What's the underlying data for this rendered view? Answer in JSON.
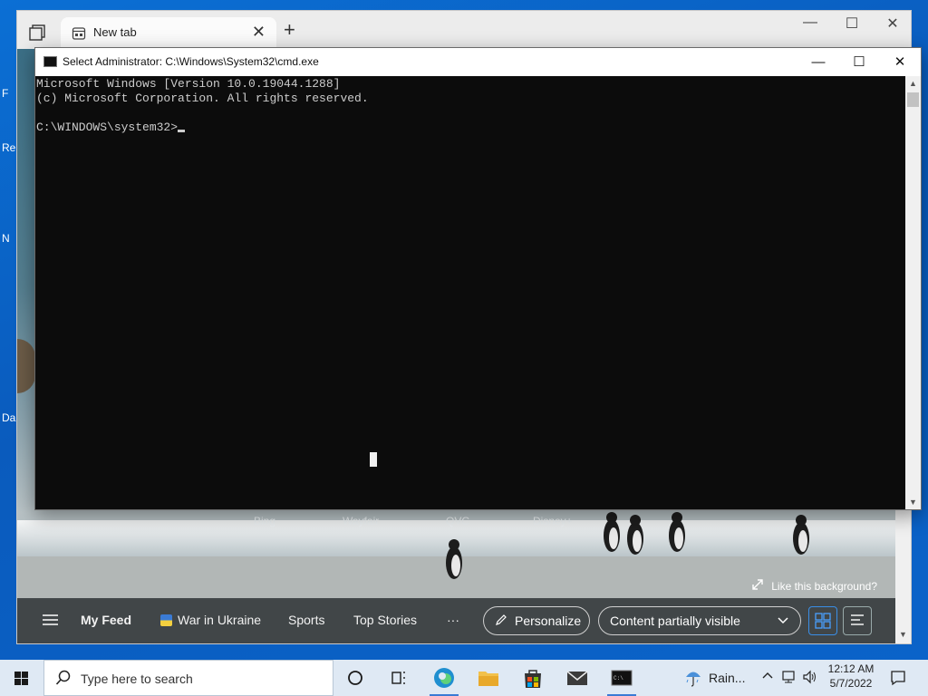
{
  "desktop": {
    "fragments": [
      "Re",
      "F",
      "N",
      "Da"
    ]
  },
  "edge": {
    "tab": {
      "title": "New tab"
    },
    "quick_links": [
      "Bing",
      "Wayfair",
      "QVC",
      "Disney+"
    ],
    "background_link": "Like this background?",
    "feed": {
      "my_feed": "My Feed",
      "war_in_ukraine": "War in Ukraine",
      "sports": "Sports",
      "top_stories": "Top Stories",
      "more": "···",
      "personalize": "Personalize",
      "content_visibility": "Content partially visible"
    }
  },
  "cmd": {
    "title": "Select Administrator: C:\\Windows\\System32\\cmd.exe",
    "lines": [
      "Microsoft Windows [Version 10.0.19044.1288]",
      "(c) Microsoft Corporation. All rights reserved.",
      ""
    ],
    "prompt": "C:\\WINDOWS\\system32>"
  },
  "taskbar": {
    "search_placeholder": "Type here to search",
    "weather": "Rain...",
    "time": "12:12 AM",
    "date": "5/7/2022"
  },
  "colors": {
    "accent": "#3a7bd5",
    "cmd_bg": "#0c0c0c",
    "cmd_text": "#cccccc"
  }
}
